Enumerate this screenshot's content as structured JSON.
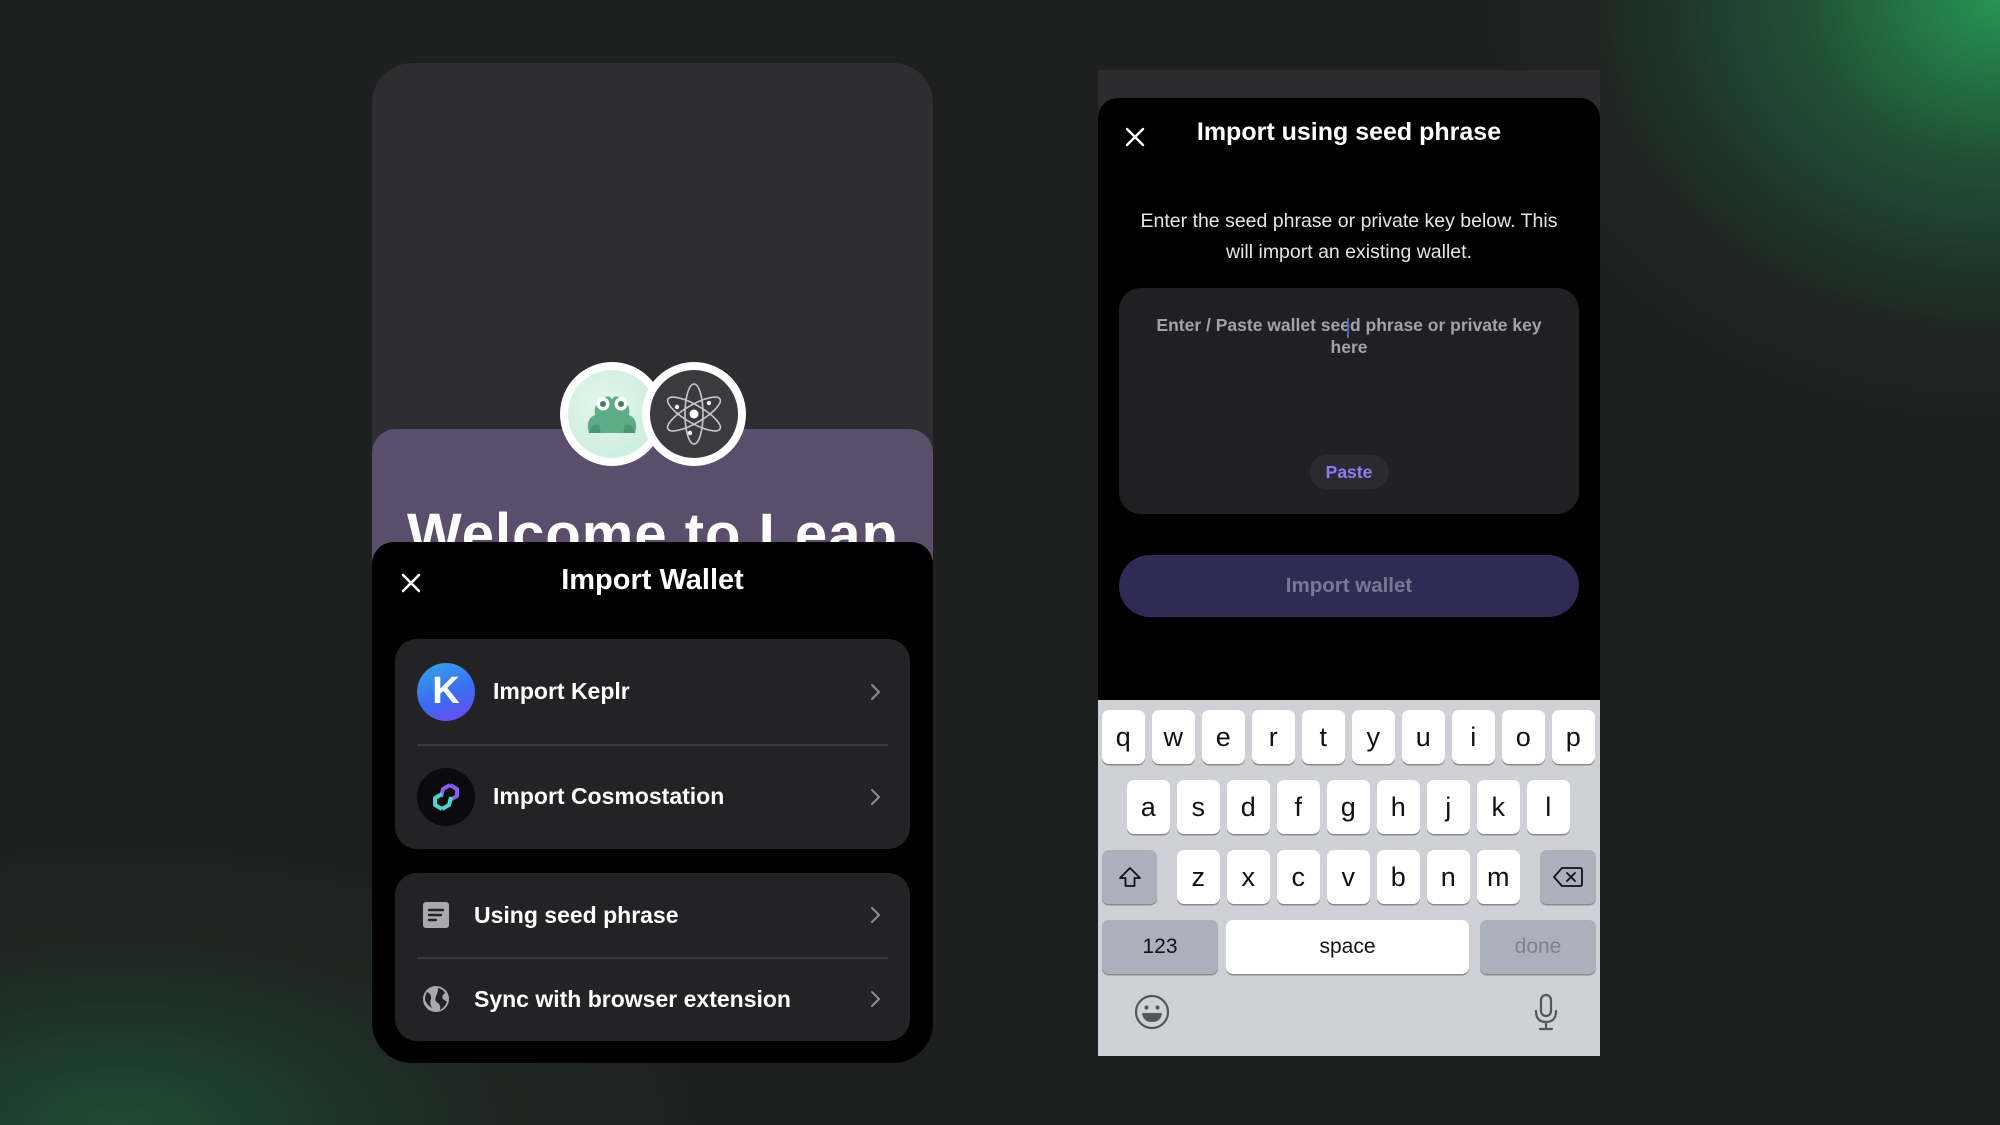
{
  "left_screen": {
    "welcome_title": "Welcome to Leap",
    "logos": [
      {
        "name": "frog-logo",
        "icon": "frog-icon"
      },
      {
        "name": "cosmos-logo",
        "icon": "atom-icon"
      }
    ],
    "sheet": {
      "title": "Import Wallet",
      "close_icon": "close-icon",
      "wallet_options": [
        {
          "label": "Import Keplr",
          "icon": "keplr-icon",
          "icon_letter": "K"
        },
        {
          "label": "Import Cosmostation",
          "icon": "cosmostation-icon"
        }
      ],
      "other_options": [
        {
          "label": "Using seed phrase",
          "icon": "document-icon"
        },
        {
          "label": "Sync with browser extension",
          "icon": "globe-icon"
        }
      ]
    }
  },
  "right_screen": {
    "sheet": {
      "title": "Import using seed phrase",
      "close_icon": "close-icon",
      "description": "Enter the seed phrase or private key below. This will import an existing wallet.",
      "seed_input": {
        "value": "",
        "placeholder": "Enter / Paste wallet seed phrase or private key here"
      },
      "paste_label": "Paste",
      "import_label": "Import wallet",
      "import_enabled": false
    },
    "keyboard": {
      "row1": [
        "q",
        "w",
        "e",
        "r",
        "t",
        "y",
        "u",
        "i",
        "o",
        "p"
      ],
      "row2": [
        "a",
        "s",
        "d",
        "f",
        "g",
        "h",
        "j",
        "k",
        "l"
      ],
      "row3": [
        "z",
        "x",
        "c",
        "v",
        "b",
        "n",
        "m"
      ],
      "shift_icon": "shift-icon",
      "backspace_icon": "backspace-icon",
      "numbers_label": "123",
      "space_label": "space",
      "done_label": "done",
      "emoji_icon": "emoji-icon",
      "mic_icon": "microphone-icon"
    }
  },
  "colors": {
    "accent_purple": "#8c7cf0",
    "welcome_panel": "#5b4d6c",
    "import_button_disabled": "#302b55",
    "background_glow": "#269b55"
  }
}
